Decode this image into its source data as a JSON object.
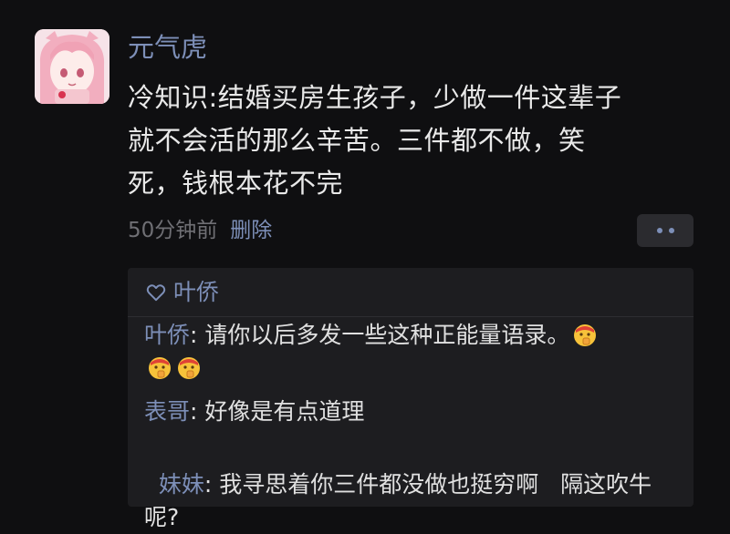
{
  "post": {
    "nickname": "元气虎",
    "text": "冷知识:结婚买房生孩子，少做一件这辈子\n就不会活的那么辛苦。三件都不做，笑\n死，钱根本花不完",
    "time": "50分钟前",
    "delete_label": "删除"
  },
  "likes": {
    "icon": "heart-outline-icon",
    "names": "叶侨"
  },
  "comments": [
    {
      "author": "叶侨",
      "sep": ": ",
      "text": "请你以后多发一些这种正能量语录。",
      "emojis": [
        "shushing-face-emoji",
        "shushing-face-emoji",
        "shushing-face-emoji"
      ]
    },
    {
      "author": "表哥",
      "sep": ": ",
      "text": "好像是有点道理"
    },
    {
      "author": "妹妹",
      "sep": ": ",
      "text": "我寻思着你三件都没做也挺穷啊   隔这吹牛呢?"
    }
  ],
  "colors": {
    "link": "#7d8fb8",
    "background": "#0f0f11",
    "panel": "#1d1d20"
  }
}
